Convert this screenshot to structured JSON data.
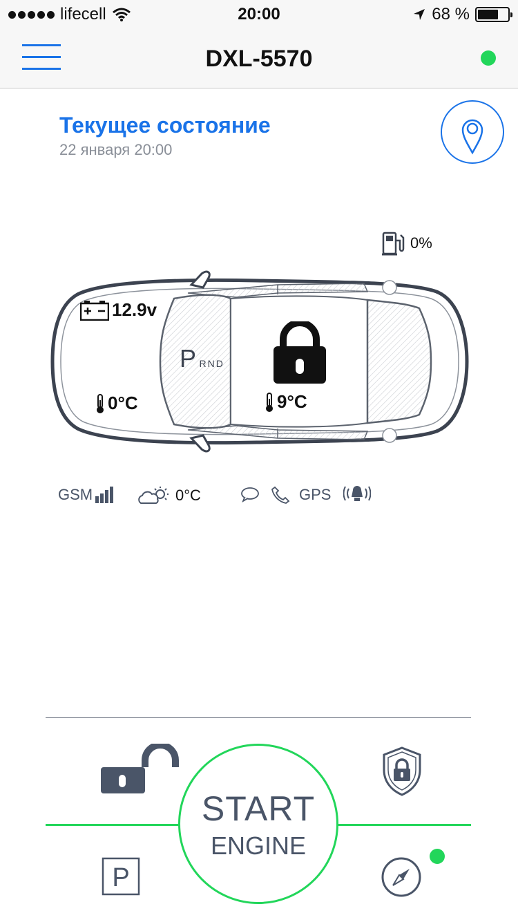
{
  "status_bar": {
    "carrier": "lifecell",
    "time": "20:00",
    "battery_percent": "68 %",
    "battery_level": 0.68,
    "icons": [
      "signal-dots-icon",
      "wifi-icon",
      "location-arrow-icon",
      "battery-icon"
    ]
  },
  "nav": {
    "title": "DXL-5570",
    "menu_icon": "hamburger-icon",
    "connection_color": "#22d65a"
  },
  "header": {
    "title": "Текущее состояние",
    "date": "22 января 20:00",
    "map_icon": "map-pin-icon"
  },
  "car": {
    "fuel": "0%",
    "voltage": "12.9v",
    "gear_selected": "P",
    "gear_others": "RND",
    "temp_outside": "0°C",
    "temp_inside": "9°C",
    "lock_state_icon": "padlock-closed-icon"
  },
  "indicators": {
    "gsm": "GSM",
    "weather_temp": "0°C",
    "gps": "GPS",
    "icons": [
      "signal-bars-icon",
      "cloud-sun-icon",
      "chat-bubble-icon",
      "phone-icon",
      "alarm-siren-icon"
    ]
  },
  "controls": {
    "start_line1": "START",
    "start_line2": "ENGINE",
    "unlock_icon": "padlock-open-icon",
    "guard_icon": "shield-lock-icon",
    "parking_icon": "parking-icon",
    "nav_icon": "compass-icon",
    "accent_color": "#22d65a"
  }
}
